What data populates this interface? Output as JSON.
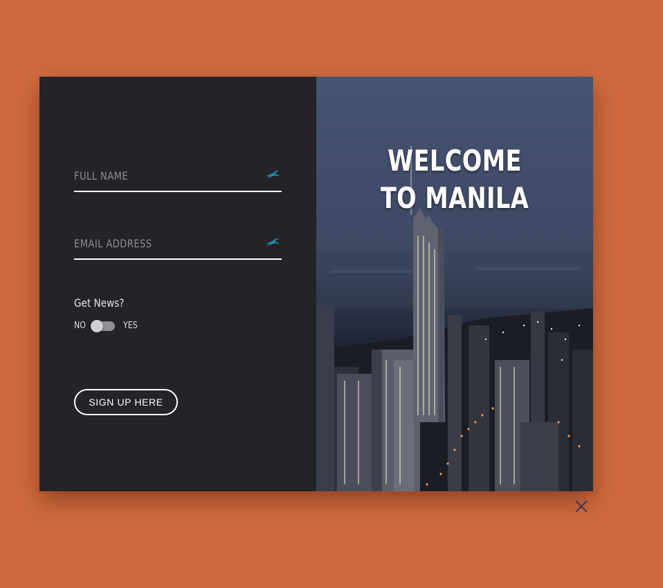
{
  "form": {
    "full_name_placeholder": "FULL NAME",
    "email_placeholder": "EMAIL ADDRESS",
    "news_question": "Get News?",
    "toggle_no": "NO",
    "toggle_yes": "YES",
    "signup_label": "SIGN UP HERE"
  },
  "hero": {
    "welcome_line1": "WELCOME",
    "welcome_line2": "TO MANILA"
  },
  "icons": {
    "field_icon": "bird-icon",
    "close": "close-icon"
  },
  "colors": {
    "background": "#cf6a3f",
    "panel": "#232328",
    "accent": "#1e8fb0",
    "close_icon": "#2a2f5a"
  }
}
